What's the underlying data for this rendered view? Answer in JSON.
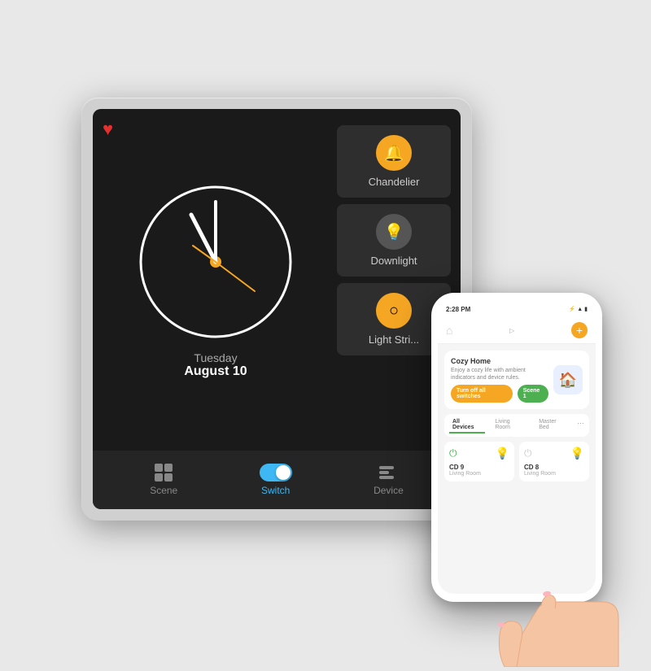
{
  "panel": {
    "clock": {
      "day": "Tuesday",
      "date": "August 10",
      "hour_angle": -60,
      "minute_angle": 0,
      "second_angle": 45
    },
    "lights": [
      {
        "id": "chandelier",
        "label": "Chandelier",
        "active": true
      },
      {
        "id": "downlight",
        "label": "Downlight",
        "active": false
      },
      {
        "id": "light_strip",
        "label": "Light Stri...",
        "active": true
      }
    ],
    "nav": [
      {
        "id": "scene",
        "label": "Scene",
        "active": false
      },
      {
        "id": "switch",
        "label": "Switch",
        "active": true
      },
      {
        "id": "device",
        "label": "Device",
        "active": false
      }
    ]
  },
  "phone": {
    "status_bar": {
      "time": "2:28 PM",
      "battery": "■"
    },
    "home_card": {
      "title": "Cozy Home",
      "description": "Enjoy a cozy life with ambient indicators and device rules.",
      "btn_off": "Turn off all switches",
      "btn_scene": "Scene 1"
    },
    "tabs": [
      {
        "label": "All Devices",
        "active": true
      },
      {
        "label": "Living Room",
        "active": false
      },
      {
        "label": "Master Bed",
        "active": false
      }
    ],
    "devices": [
      {
        "name": "CD 9",
        "room": "Living Room",
        "on": true
      },
      {
        "name": "CD 8",
        "room": "Living Room",
        "on": false
      }
    ]
  }
}
